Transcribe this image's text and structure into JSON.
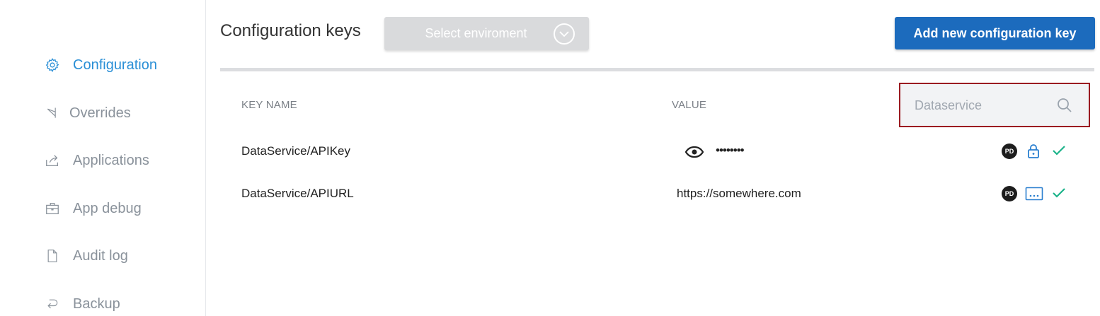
{
  "sidebar": {
    "items": [
      {
        "label": "Configuration",
        "icon": "gear-icon",
        "active": true
      },
      {
        "label": "Overrides",
        "icon": "flag-icon",
        "active": false
      },
      {
        "label": "Applications",
        "icon": "share-icon",
        "active": false
      },
      {
        "label": "App debug",
        "icon": "briefcase-icon",
        "active": false
      },
      {
        "label": "Audit log",
        "icon": "document-icon",
        "active": false
      },
      {
        "label": "Backup",
        "icon": "return-arrow-icon",
        "active": false
      }
    ]
  },
  "header": {
    "title": "Configuration keys",
    "env_select_label": "Select enviroment",
    "add_button_label": "Add new configuration key"
  },
  "table": {
    "columns": {
      "key": "KEY NAME",
      "value": "VALUE"
    },
    "search": {
      "value": "",
      "placeholder": "Dataservice"
    },
    "rows": [
      {
        "key": "DataService/APIKey",
        "value": "••••••••",
        "masked": true,
        "avatar": "PD",
        "icons": [
          "eye-icon",
          "lock-icon",
          "check-icon"
        ]
      },
      {
        "key": "DataService/APIURL",
        "value": "https://somewhere.com",
        "masked": false,
        "avatar": "PD",
        "icons": [
          "more-icon",
          "check-icon"
        ]
      }
    ]
  },
  "colors": {
    "accent": "#2a8fd6",
    "primary_button": "#1c6bbd",
    "highlight_border": "#9b1b21",
    "check": "#1cb38a"
  }
}
